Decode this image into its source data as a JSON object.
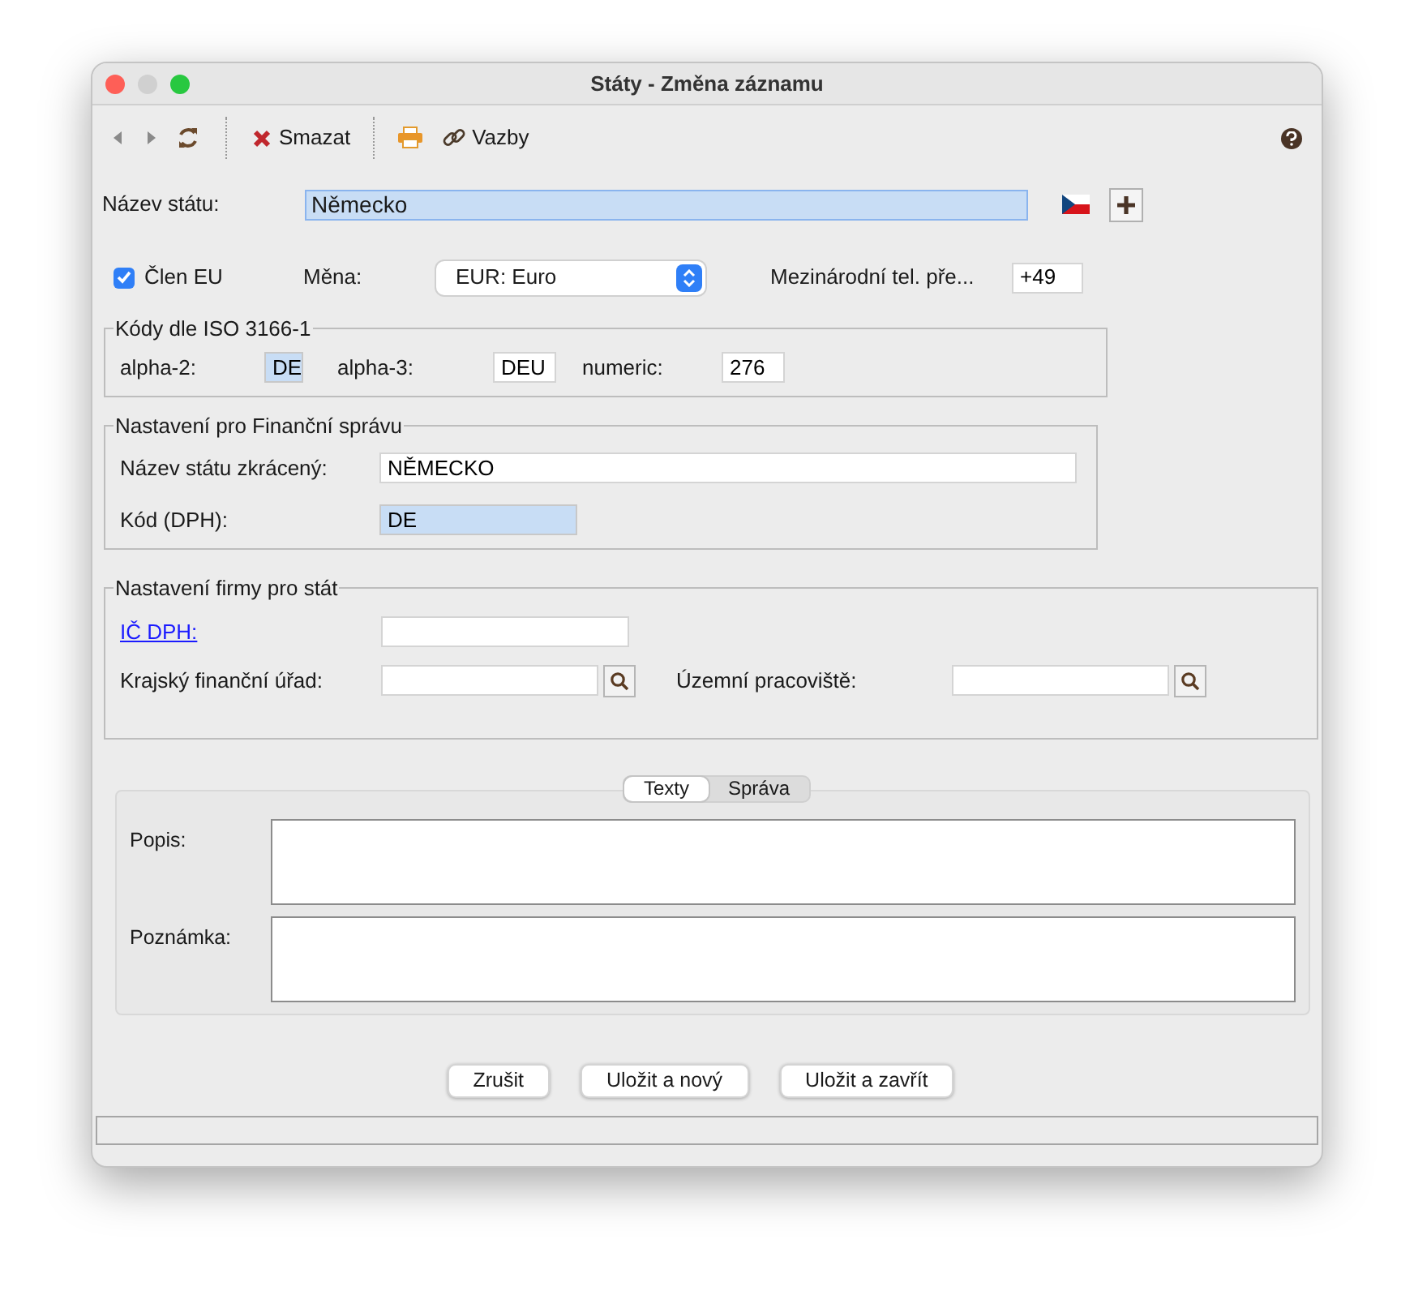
{
  "window": {
    "title": "Státy - Změna záznamu"
  },
  "toolbar": {
    "delete_label": "Smazat",
    "links_label": "Vazby"
  },
  "name": {
    "label": "Název státu:",
    "value": "Německo",
    "highlighted": true
  },
  "eu_member": {
    "label": "Člen EU",
    "checked": true
  },
  "currency": {
    "label": "Měna:",
    "value": "EUR: Euro"
  },
  "phone_prefix": {
    "label": "Mezinárodní tel. pře...",
    "value": "+49"
  },
  "iso": {
    "title": "Kódy dle ISO 3166-1",
    "fields": [
      {
        "label": "alpha-2:",
        "value": "DE",
        "highlighted": true
      },
      {
        "label": "alpha-3:",
        "value": "DEU",
        "highlighted": false
      },
      {
        "label": "numeric:",
        "value": "276",
        "highlighted": false
      }
    ]
  },
  "finance": {
    "title": "Nastavení pro Finanční správu",
    "fields": [
      {
        "label": "Název státu zkrácený:",
        "value": "NĚMECKO",
        "highlighted": false
      },
      {
        "label": "Kód (DPH):",
        "value": "DE",
        "highlighted": true
      }
    ]
  },
  "company": {
    "title": "Nastavení firmy pro stát",
    "vat_label": "IČ DPH:",
    "lookups": [
      {
        "label": "Krajský finanční úřad:"
      },
      {
        "label": "Územní pracoviště:"
      }
    ]
  },
  "tabs": [
    {
      "label": "Texty",
      "selected": true
    },
    {
      "label": "Správa",
      "selected": false
    }
  ],
  "text_fields": [
    {
      "label": "Popis:"
    },
    {
      "label": "Poznámka:"
    }
  ],
  "buttons": [
    "Zrušit",
    "Uložit a nový",
    "Uložit a zavřít"
  ]
}
